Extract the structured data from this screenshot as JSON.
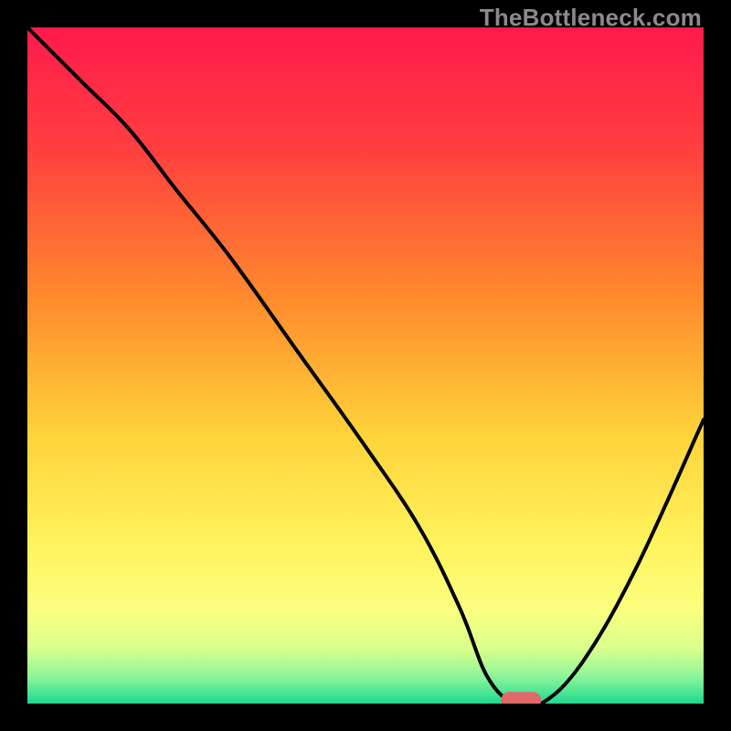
{
  "watermark": {
    "text": "TheBottleneck.com"
  },
  "chart_data": {
    "type": "line",
    "title": "",
    "xlabel": "",
    "ylabel": "",
    "xlim": [
      0,
      100
    ],
    "ylim": [
      0,
      100
    ],
    "grid": false,
    "legend": false,
    "background_gradient": {
      "stops": [
        {
          "pct": 0,
          "color": "#ff1a4b"
        },
        {
          "pct": 18,
          "color": "#ff3f3f"
        },
        {
          "pct": 40,
          "color": "#ff8a2d"
        },
        {
          "pct": 60,
          "color": "#ffd23a"
        },
        {
          "pct": 75,
          "color": "#fff05a"
        },
        {
          "pct": 86,
          "color": "#fbff7e"
        },
        {
          "pct": 92,
          "color": "#d8ff8c"
        },
        {
          "pct": 96,
          "color": "#8cf59a"
        },
        {
          "pct": 100,
          "color": "#1fd98f"
        }
      ]
    },
    "series": [
      {
        "name": "bottleneck-curve",
        "color": "#000000",
        "x": [
          0,
          8,
          15,
          22,
          30,
          40,
          50,
          58,
          64,
          68,
          72,
          76,
          82,
          90,
          100
        ],
        "y": [
          100,
          92,
          85,
          76,
          66,
          52,
          38,
          26,
          14,
          4,
          0,
          0,
          6,
          20,
          42
        ]
      }
    ],
    "marker": {
      "name": "optimal-point",
      "x": 73,
      "y": 0.5,
      "color": "#e06a6a",
      "shape": "rounded-bar"
    }
  }
}
